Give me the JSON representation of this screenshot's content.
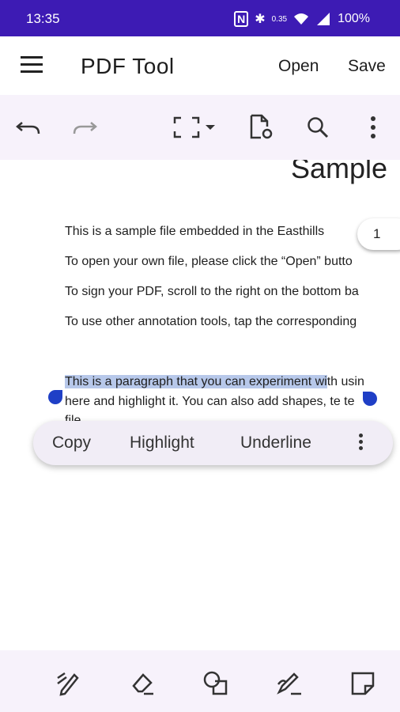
{
  "status_bar": {
    "time": "13:35",
    "battery": "100%",
    "icons": [
      "nfc-icon",
      "bluetooth-icon",
      "data-speed-icon",
      "wifi-icon",
      "signal-icon"
    ],
    "data_speed": "0.35"
  },
  "app_bar": {
    "title": "PDF Tool",
    "open_label": "Open",
    "save_label": "Save"
  },
  "toolbar": {
    "icons": [
      "undo-icon",
      "redo-icon",
      "fit-screen-icon",
      "dropdown-icon",
      "document-settings-icon",
      "search-icon",
      "more-vert-icon"
    ]
  },
  "document": {
    "heading": "Sample",
    "lines": [
      "This is a sample file embedded in the Easthills",
      "To open your own file, please click the “Open” butto",
      "To sign your PDF, scroll to the right on the bottom ba",
      "To use other annotation tools, tap the corresponding"
    ],
    "para_selected": "This is a paragraph that you can experiment wi",
    "para_rest": "th usin",
    "para_line2": "here and highlight it. You can also add shapes, ",
    "para_line2_end": "te te",
    "para_line3": "file",
    "page_number": "1"
  },
  "context_menu": {
    "copy": "Copy",
    "highlight": "Highlight",
    "underline": "Underline"
  },
  "bottom_bar": {
    "icons": [
      "draw-icon",
      "eraser-icon",
      "shapes-icon",
      "signature-icon",
      "sticky-note-icon"
    ]
  },
  "colors": {
    "status_bar": "#3d1bb4",
    "toolbar_bg": "#f7f2fb",
    "selection": "#b7c8ea",
    "handle": "#1f3fc6"
  }
}
